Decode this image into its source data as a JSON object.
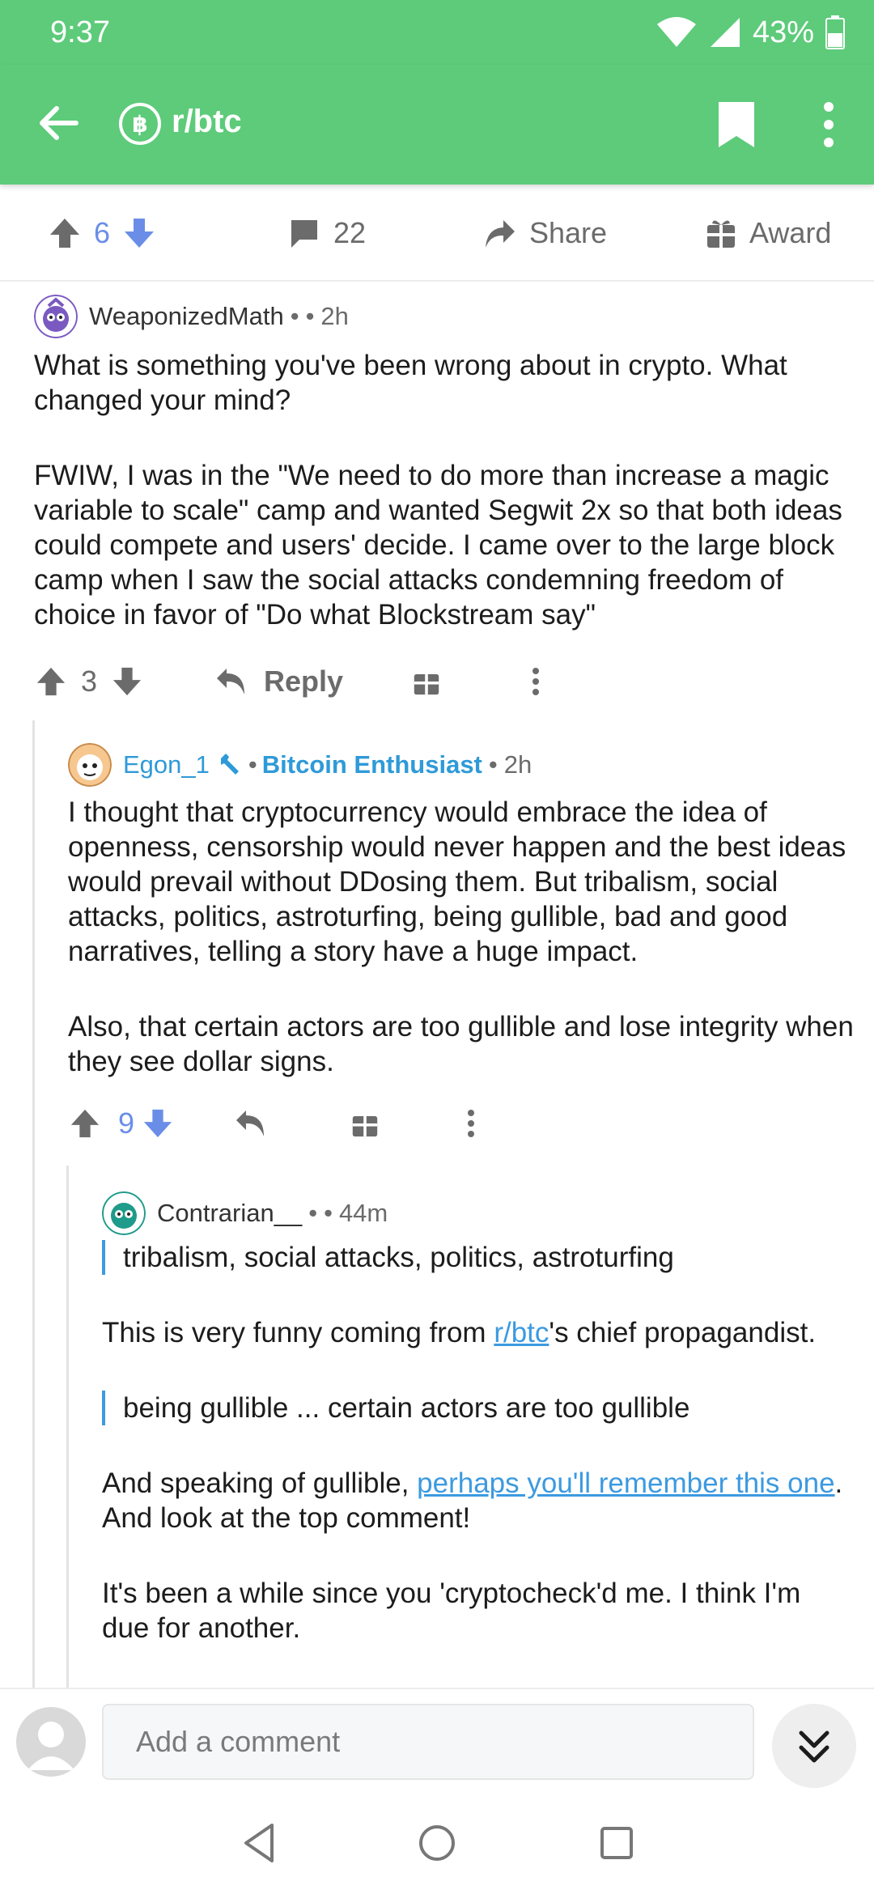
{
  "status": {
    "time": "9:37",
    "battery": "43%"
  },
  "appbar": {
    "subreddit": "r/btc"
  },
  "post_actions": {
    "score": "6",
    "comments": "22",
    "share": "Share",
    "award": "Award"
  },
  "comments": [
    {
      "author": "WeaponizedMath",
      "separator": "•",
      "separator2": "•",
      "time": "2h",
      "body": [
        "What is something you've been wrong about in crypto. What changed your mind?",
        "FWIW, I was in the \"We need to do more than increase a magic variable to scale\" camp and wanted Segwit 2x so that both ideas could compete and users' decide. I came over to the large block camp when I saw the social attacks condemning freedom of choice in favor of \"Do what Blockstream say\""
      ],
      "score": "3",
      "reply": "Reply"
    },
    {
      "author": "Egon_1",
      "separator": "•",
      "flair": "Bitcoin Enthusiast",
      "separator2": "•",
      "time": "2h",
      "body": [
        "I thought that cryptocurrency would embrace the idea of openness, censorship would never happen and the best ideas would prevail without DDosing them. But tribalism, social attacks, politics, astroturfing, being gullible, bad and good narratives, telling a story have a huge impact.",
        "Also, that certain actors are too gullible and lose integrity when they see dollar signs."
      ],
      "score": "9"
    },
    {
      "author": "Contrarian__",
      "separator": "•",
      "separator2": "•",
      "time": "44m",
      "quote1": "tribalism, social attacks, politics, astroturfing",
      "p1_before": "This is very funny coming from ",
      "p1_link": "r/btc",
      "p1_after": "'s chief propagandist.",
      "quote2": "being gullible ... certain actors are too gullible",
      "p2_before": "And speaking of gullible, ",
      "p2_link": "perhaps you'll remember this one",
      "p2_after": ". And look at the top comment!",
      "p3": "It's been a while since you 'cryptocheck'd me. I think I'm due for another."
    }
  ],
  "compose": {
    "placeholder": "Add a comment"
  },
  "colors": {
    "brand_green": "#5dcb7a",
    "upvote_blue": "#6a8ee8",
    "link_blue": "#3c9ae0",
    "quote_bar": "#3c9ae0"
  }
}
